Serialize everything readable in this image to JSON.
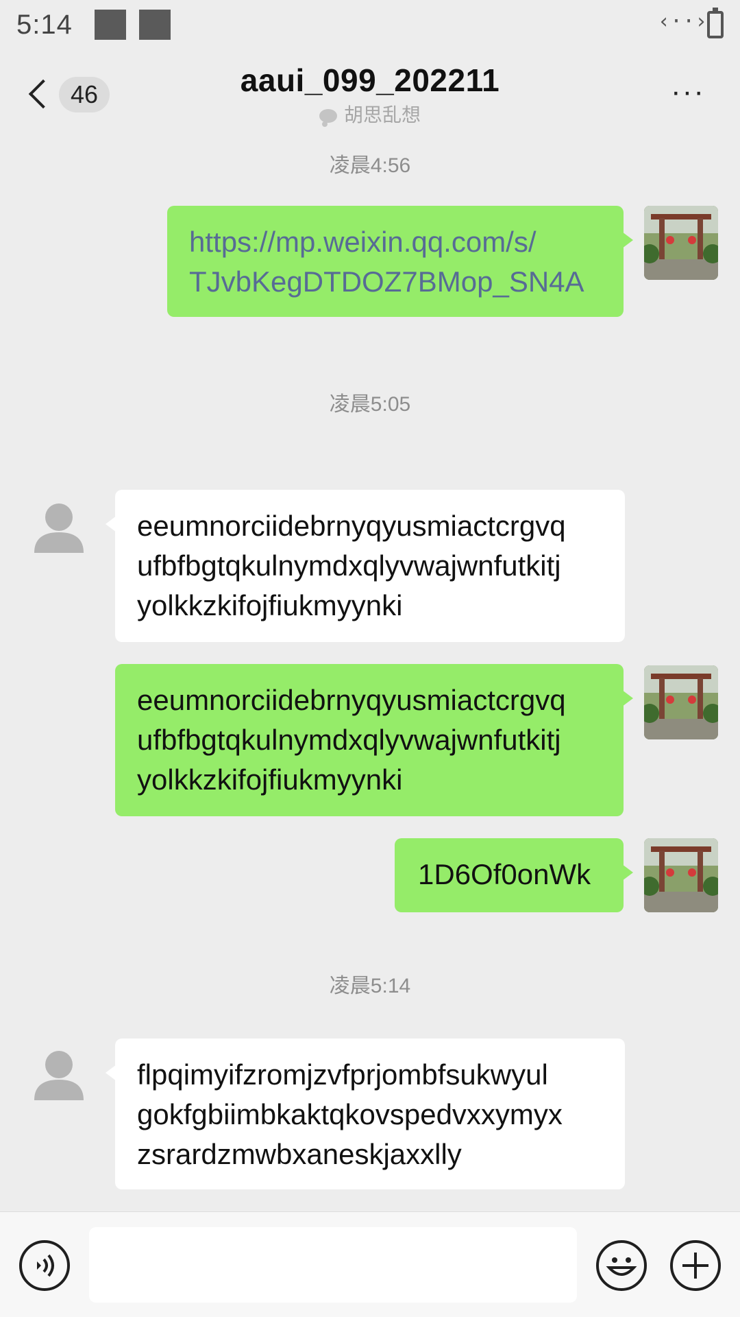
{
  "status_bar": {
    "time": "5:14",
    "data_indicator": "‹··›"
  },
  "header": {
    "unread_count": "46",
    "title": "aaui_099_202211",
    "subtitle": "胡思乱想",
    "more": "···"
  },
  "chat": {
    "timestamps": [
      "凌晨4:56",
      "凌晨5:05",
      "凌晨5:14"
    ],
    "messages": [
      {
        "direction": "sent",
        "lines": [
          "https://mp.weixin.qq.com/s/",
          "TJvbKegDTDOZ7BMop_SN4A"
        ],
        "type": "link"
      },
      {
        "direction": "received",
        "lines": [
          "eeumnorciidebrnyqyusmiactcrgvq",
          "ufbfbgtqkulnymdxqlyvwajwnfutkitj",
          "yolkkzkifojfiukmyynki"
        ]
      },
      {
        "direction": "sent",
        "lines": [
          "eeumnorciidebrnyqyusmiactcrgvq",
          "ufbfbgtqkulnymdxqlyvwajwnfutkitj",
          "yolkkzkifojfiukmyynki"
        ]
      },
      {
        "direction": "sent",
        "lines": [
          "1D6Of0onWk"
        ]
      },
      {
        "direction": "received",
        "lines": [
          "flpqimyifzromjzvfprjombfsukwyul",
          "gokfgbiimbkaktqkovspedvxxymyx",
          "zsrardzmwbxaneskjaxxlly"
        ]
      }
    ]
  },
  "input_bar": {
    "value": ""
  },
  "colors": {
    "sent_bubble": "#95ec69",
    "received_bubble": "#ffffff",
    "link": "#576b95",
    "background": "#ededed"
  },
  "icons": [
    "back-icon",
    "more-icon",
    "voice-icon",
    "emoji-icon",
    "plus-icon",
    "default-avatar-icon",
    "chat-bubble-icon"
  ]
}
